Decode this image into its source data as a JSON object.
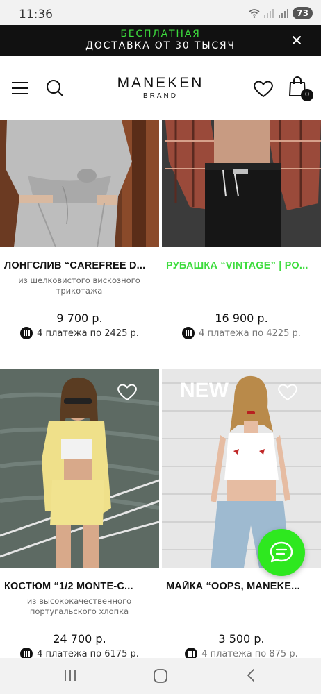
{
  "status_bar": {
    "time": "11:36",
    "battery": "73"
  },
  "promo": {
    "line1": "БЕСПЛАТНАЯ",
    "line2": "ДОСТАВКА ОТ 30 ТЫСЯЧ",
    "accent_color": "#3ddc3d"
  },
  "header": {
    "logo_main": "MANEKEN",
    "logo_sub": "BRAND",
    "cart_count": "0",
    "icons": [
      "menu-icon",
      "search-icon",
      "heart-icon",
      "bag-icon"
    ]
  },
  "products": [
    {
      "title": "ЛОНГСЛИВ “CAREFREE D...",
      "title_color": "#111111",
      "description": "из шелковистого вискозного трикотажа",
      "price": "9 700 р.",
      "installment": "4 платежа по 2425 р."
    },
    {
      "title": "РУБАШКА “VINTAGE” | РО...",
      "title_color": "#3ddc3d",
      "description": "",
      "price": "16 900 р.",
      "installment": "4 платежа по 4225 р."
    },
    {
      "title": "КОСТЮМ “1/2 MONTE-C...",
      "title_color": "#111111",
      "description": "из высококачественного португальского хлопка",
      "price": "24 700 р.",
      "installment": "4 платежа по 6175 р."
    },
    {
      "title": "МАЙКА “OOPS, MANEKE...",
      "title_color": "#111111",
      "description": "",
      "price": "3 500 р.",
      "installment": "4 платежа по 875 р.",
      "badge": "NEW"
    }
  ],
  "fab": {
    "icon": "chat-icon",
    "color": "#2ee81f"
  },
  "nav": {
    "icons": [
      "recent-apps-icon",
      "home-icon",
      "back-icon"
    ]
  }
}
